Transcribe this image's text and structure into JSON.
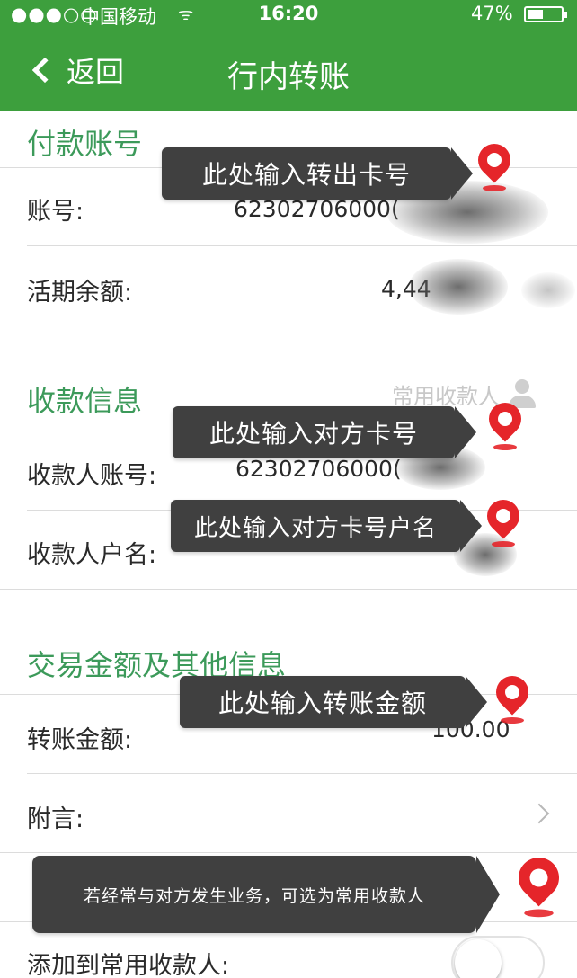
{
  "status_bar": {
    "signal": "●●●○○",
    "carrier": "中国移动",
    "time": "16:20",
    "battery": "47%",
    "battery_level": 0.47
  },
  "nav": {
    "back_label": "返回",
    "title": "行内转账"
  },
  "payer": {
    "section_title": "付款账号",
    "account_label": "账号:",
    "account_value": "62302706000(",
    "balance_label": "活期余额:",
    "balance_value": "4,44"
  },
  "payee": {
    "section_title": "收款信息",
    "favorites_link": "常用收款人",
    "account_label": "收款人账号:",
    "account_value": "62302706000(",
    "name_label": "收款人户名:"
  },
  "transaction": {
    "section_title": "交易金额及其他信息",
    "amount_label": "转账金额:",
    "amount_value": "100.00",
    "note_label": "附言:",
    "add_favorite_label": "添加到常用收款人:",
    "add_favorite_on": false
  },
  "annotations": {
    "payer_card": "此处输入转出卡号",
    "payee_card": "此处输入对方卡号",
    "payee_name": "此处输入对方卡号户名",
    "amount": "此处输入转账金额",
    "favorite_hint": "若经常与对方发生业务，可选为常用收款人"
  },
  "colors": {
    "header_green": "#3d9f3d",
    "section_green": "#3c9a5a",
    "pin_red": "#e5252a",
    "tooltip_bg": "#404040"
  }
}
